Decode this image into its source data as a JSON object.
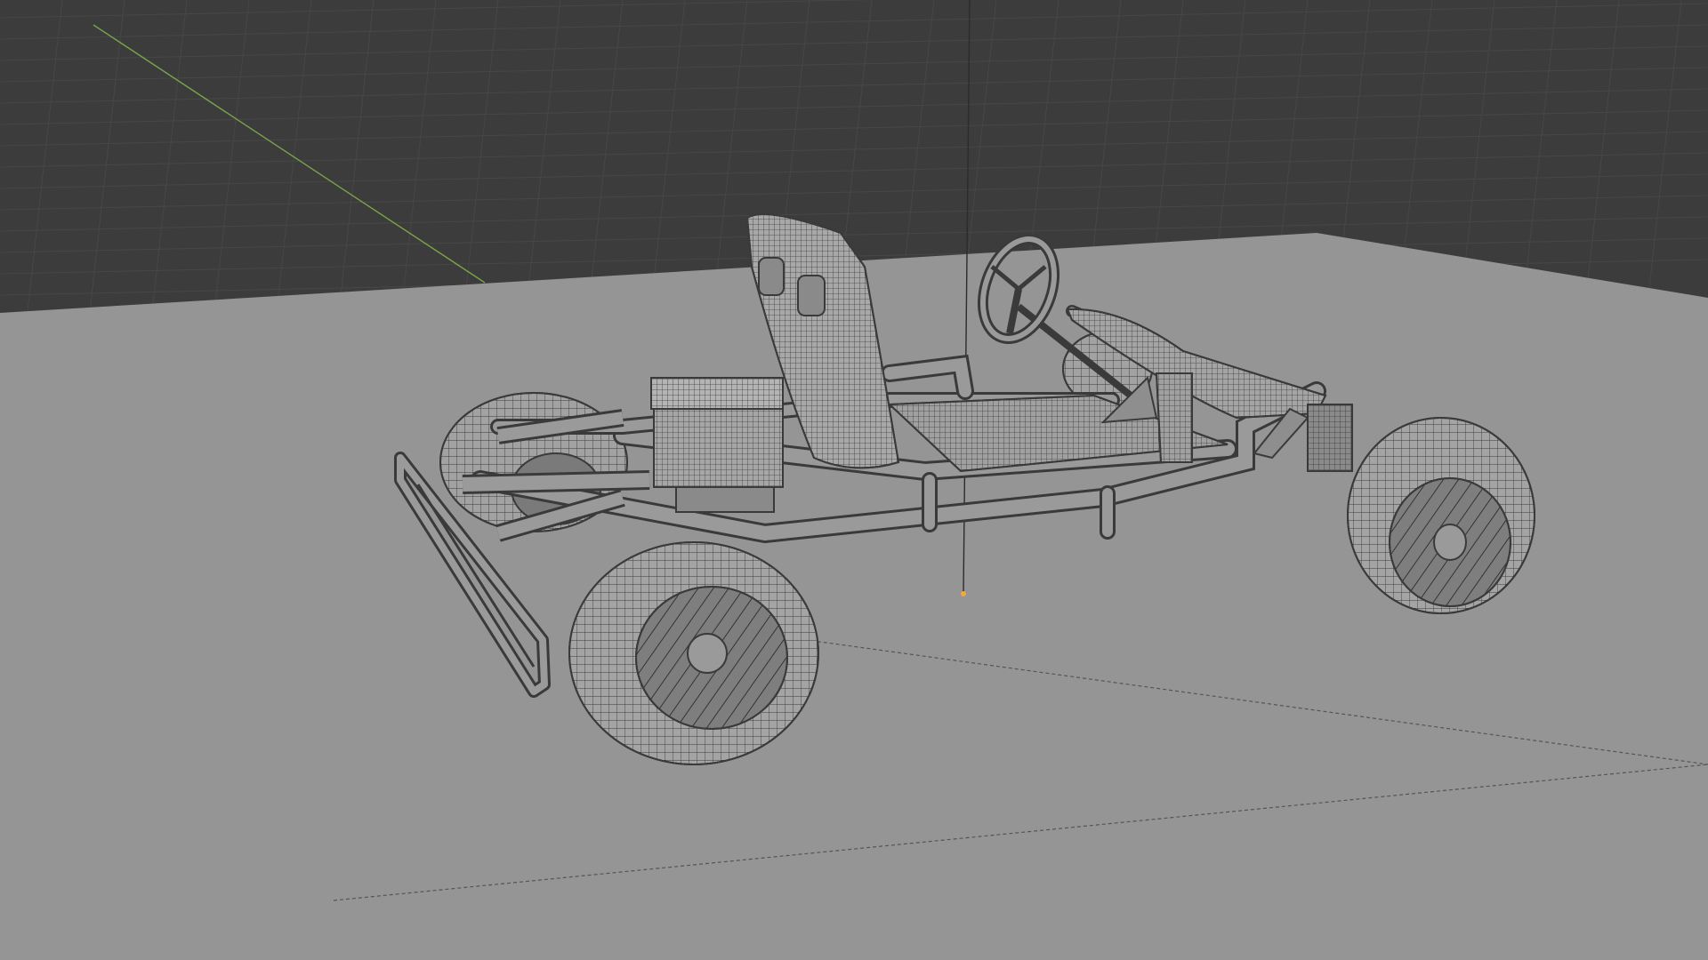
{
  "viewport": {
    "colors": {
      "world_background": "#3c3c3c",
      "grid_line": "#474747",
      "ground_plane": "#959595",
      "x_axis": "#c9454f",
      "y_axis": "#7ba34a",
      "z_axis": "#2c2c2c",
      "origin": "#f2a93b",
      "wire": "#3b3b3b",
      "mesh_fill": "#9a9a9a",
      "tire_fill": "#a4a4a4",
      "rim_fill": "#7e7e7e"
    }
  }
}
